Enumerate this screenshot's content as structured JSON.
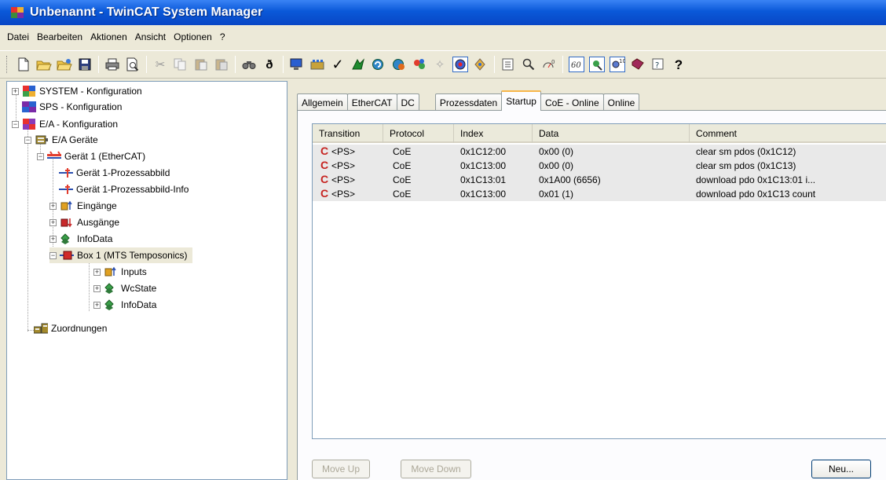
{
  "window": {
    "title": "Unbenannt - TwinCAT System Manager"
  },
  "menu": [
    "Datei",
    "Bearbeiten",
    "Aktionen",
    "Ansicht",
    "Optionen",
    "?"
  ],
  "tree": {
    "system": "SYSTEM - Konfiguration",
    "sps": "SPS - Konfiguration",
    "ea": "E/A - Konfiguration",
    "ea_geraete": "E/A Geräte",
    "geraet1": "Gerät 1 (EtherCAT)",
    "prozessabbild": "Gerät 1-Prozessabbild",
    "prozessabbild_info": "Gerät 1-Prozessabbild-Info",
    "eingaenge": "Eingänge",
    "ausgaenge": "Ausgänge",
    "infodata": "InfoData",
    "box1": "Box 1 (MTS Temposonics)",
    "inputs": "Inputs",
    "wcstate": "WcState",
    "box_infodata": "InfoData",
    "zuordnungen": "Zuordnungen"
  },
  "tabs": [
    "Allgemein",
    "EtherCAT",
    "DC",
    "Prozessdaten",
    "Startup",
    "CoE - Online",
    "Online"
  ],
  "active_tab": "Startup",
  "table": {
    "columns": [
      "Transition",
      "Protocol",
      "Index",
      "Data",
      "Comment"
    ],
    "rows": [
      {
        "icon": "C",
        "transition": "<PS>",
        "protocol": "CoE",
        "index": "0x1C12:00",
        "data": "0x00 (0)",
        "comment": "clear sm pdos (0x1C12)"
      },
      {
        "icon": "C",
        "transition": "<PS>",
        "protocol": "CoE",
        "index": "0x1C13:00",
        "data": "0x00 (0)",
        "comment": "clear sm pdos (0x1C13)"
      },
      {
        "icon": "C",
        "transition": "<PS>",
        "protocol": "CoE",
        "index": "0x1C13:01",
        "data": "0x1A00 (6656)",
        "comment": "download pdo 0x1C13:01 i..."
      },
      {
        "icon": "C",
        "transition": "<PS>",
        "protocol": "CoE",
        "index": "0x1C13:00",
        "data": "0x01 (1)",
        "comment": "download pdo 0x1C13 count"
      }
    ]
  },
  "buttons": {
    "move_up": "Move Up",
    "move_down": "Move Down",
    "neu": "Neu..."
  },
  "colors": {
    "titlebar": "#0a58d8",
    "selection": "#ece9d8",
    "startup_icon": "#c62320"
  }
}
